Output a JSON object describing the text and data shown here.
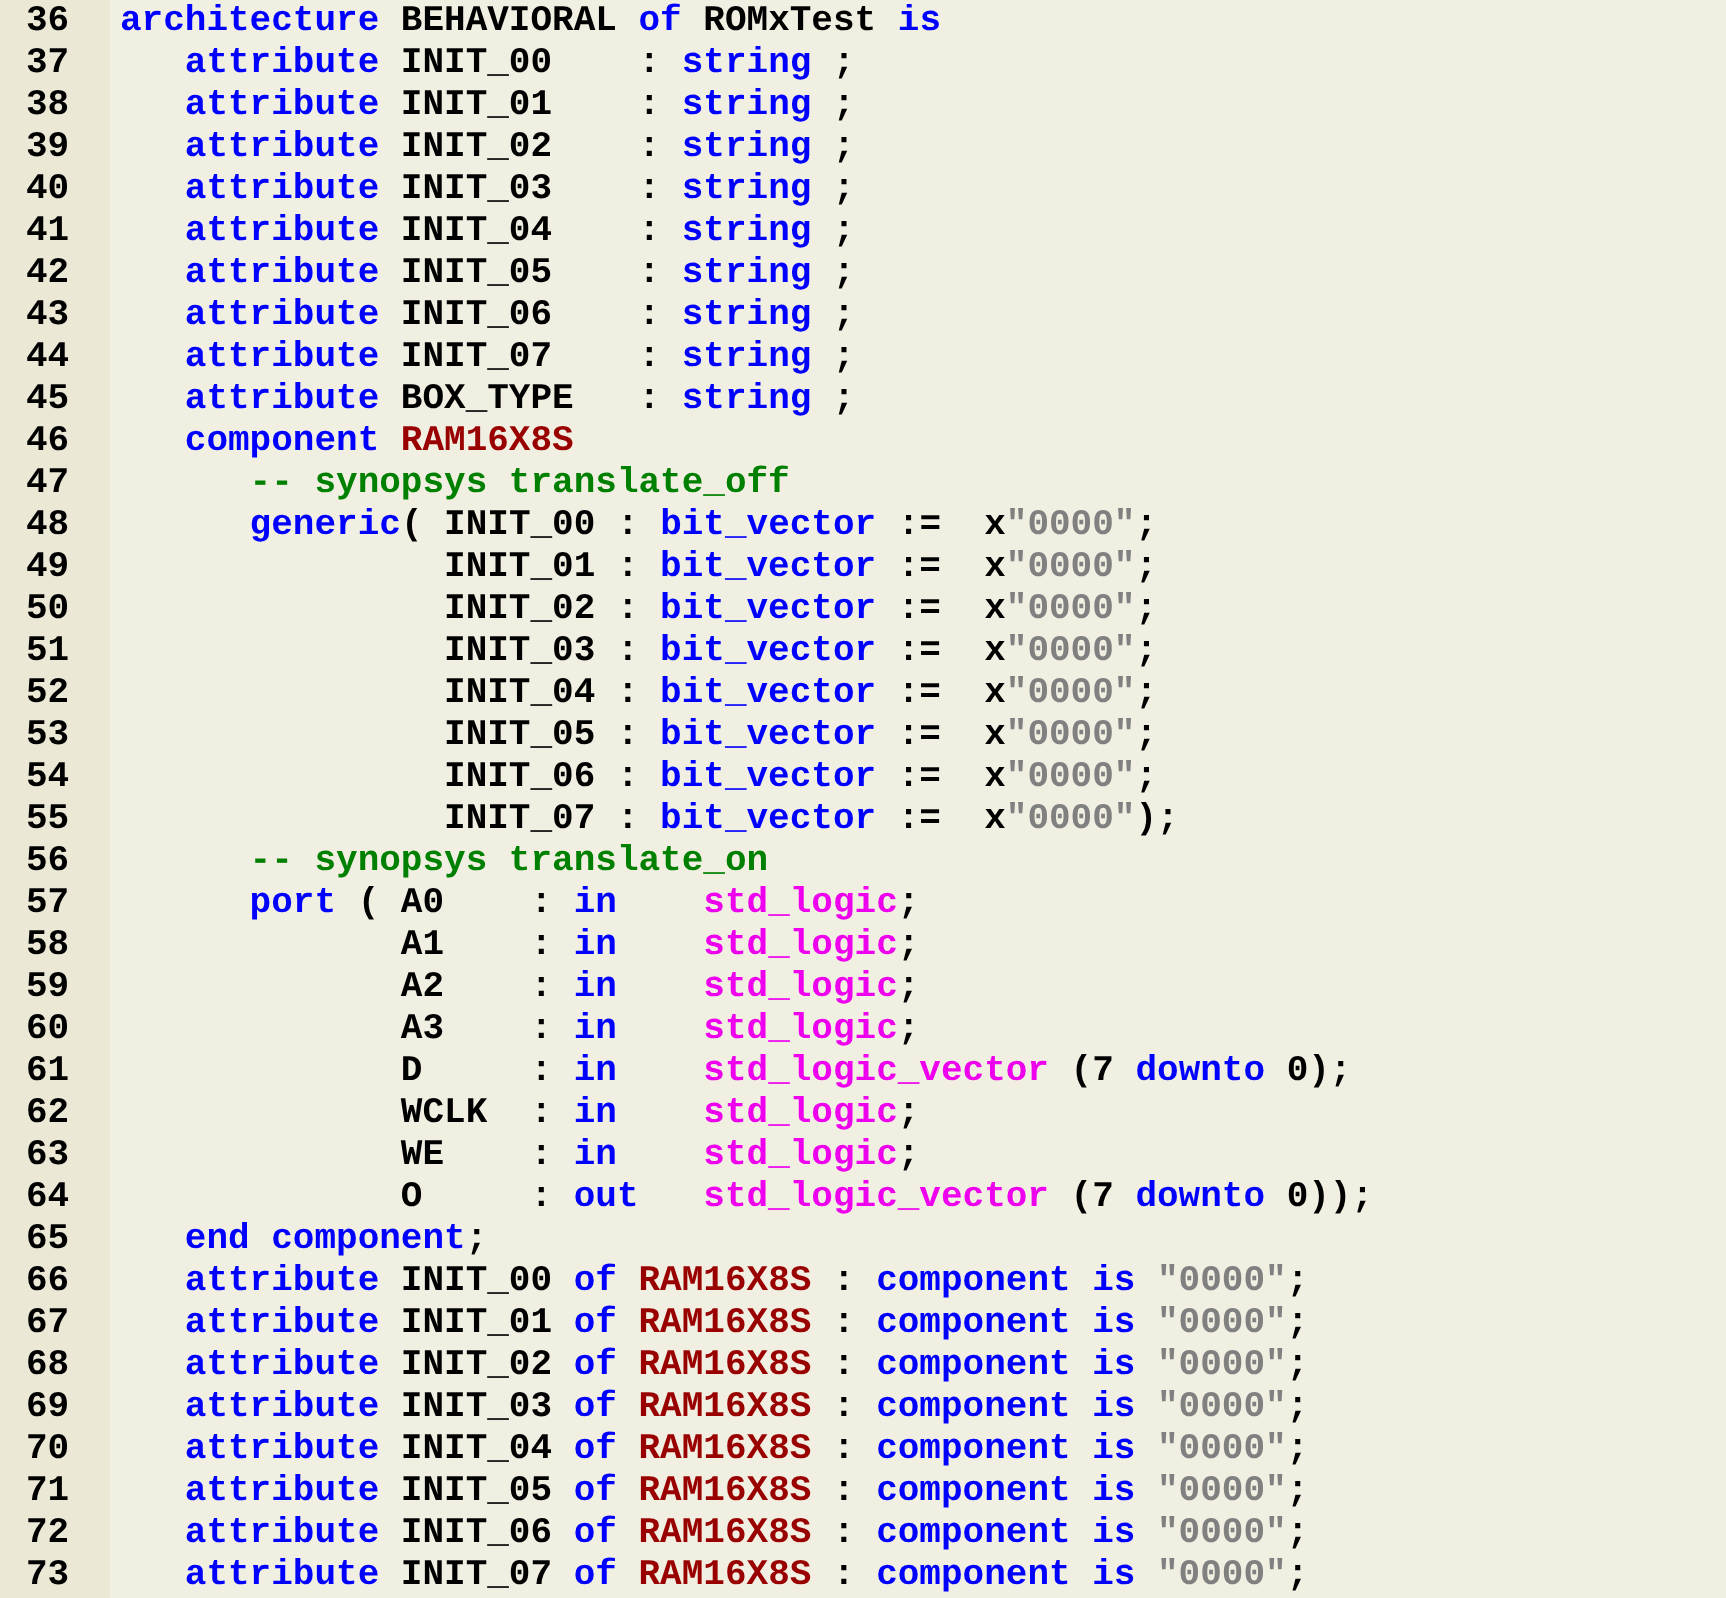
{
  "editor": {
    "lines": [
      {
        "number": "36",
        "tokens": [
          {
            "kind": "keyword",
            "text": "architecture"
          },
          {
            "kind": "plain",
            "text": " BEHAVIORAL "
          },
          {
            "kind": "keyword",
            "text": "of"
          },
          {
            "kind": "plain",
            "text": " ROMxTest "
          },
          {
            "kind": "keyword",
            "text": "is"
          }
        ]
      },
      {
        "number": "37",
        "tokens": [
          {
            "kind": "keyword",
            "text": "   attribute"
          },
          {
            "kind": "plain",
            "text": " INIT_00    : "
          },
          {
            "kind": "keyword",
            "text": "string"
          },
          {
            "kind": "plain",
            "text": " ;"
          }
        ]
      },
      {
        "number": "38",
        "tokens": [
          {
            "kind": "keyword",
            "text": "   attribute"
          },
          {
            "kind": "plain",
            "text": " INIT_01    : "
          },
          {
            "kind": "keyword",
            "text": "string"
          },
          {
            "kind": "plain",
            "text": " ;"
          }
        ]
      },
      {
        "number": "39",
        "tokens": [
          {
            "kind": "keyword",
            "text": "   attribute"
          },
          {
            "kind": "plain",
            "text": " INIT_02    : "
          },
          {
            "kind": "keyword",
            "text": "string"
          },
          {
            "kind": "plain",
            "text": " ;"
          }
        ]
      },
      {
        "number": "40",
        "tokens": [
          {
            "kind": "keyword",
            "text": "   attribute"
          },
          {
            "kind": "plain",
            "text": " INIT_03    : "
          },
          {
            "kind": "keyword",
            "text": "string"
          },
          {
            "kind": "plain",
            "text": " ;"
          }
        ]
      },
      {
        "number": "41",
        "tokens": [
          {
            "kind": "keyword",
            "text": "   attribute"
          },
          {
            "kind": "plain",
            "text": " INIT_04    : "
          },
          {
            "kind": "keyword",
            "text": "string"
          },
          {
            "kind": "plain",
            "text": " ;"
          }
        ]
      },
      {
        "number": "42",
        "tokens": [
          {
            "kind": "keyword",
            "text": "   attribute"
          },
          {
            "kind": "plain",
            "text": " INIT_05    : "
          },
          {
            "kind": "keyword",
            "text": "string"
          },
          {
            "kind": "plain",
            "text": " ;"
          }
        ]
      },
      {
        "number": "43",
        "tokens": [
          {
            "kind": "keyword",
            "text": "   attribute"
          },
          {
            "kind": "plain",
            "text": " INIT_06    : "
          },
          {
            "kind": "keyword",
            "text": "string"
          },
          {
            "kind": "plain",
            "text": " ;"
          }
        ]
      },
      {
        "number": "44",
        "tokens": [
          {
            "kind": "keyword",
            "text": "   attribute"
          },
          {
            "kind": "plain",
            "text": " INIT_07    : "
          },
          {
            "kind": "keyword",
            "text": "string"
          },
          {
            "kind": "plain",
            "text": " ;"
          }
        ]
      },
      {
        "number": "45",
        "tokens": [
          {
            "kind": "keyword",
            "text": "   attribute"
          },
          {
            "kind": "plain",
            "text": " BOX_TYPE   : "
          },
          {
            "kind": "keyword",
            "text": "string"
          },
          {
            "kind": "plain",
            "text": " ;"
          }
        ]
      },
      {
        "number": "46",
        "tokens": [
          {
            "kind": "keyword",
            "text": "   component"
          },
          {
            "kind": "name",
            "text": " RAM16X8S"
          }
        ]
      },
      {
        "number": "47",
        "tokens": [
          {
            "kind": "comment",
            "text": "      -- synopsys translate_off"
          }
        ]
      },
      {
        "number": "48",
        "tokens": [
          {
            "kind": "keyword",
            "text": "      generic"
          },
          {
            "kind": "plain",
            "text": "( INIT_00 : "
          },
          {
            "kind": "keyword",
            "text": "bit_vector"
          },
          {
            "kind": "plain",
            "text": " :=  x"
          },
          {
            "kind": "string",
            "text": "\"0000\""
          },
          {
            "kind": "plain",
            "text": ";"
          }
        ]
      },
      {
        "number": "49",
        "tokens": [
          {
            "kind": "plain",
            "text": "               INIT_01 : "
          },
          {
            "kind": "keyword",
            "text": "bit_vector"
          },
          {
            "kind": "plain",
            "text": " :=  x"
          },
          {
            "kind": "string",
            "text": "\"0000\""
          },
          {
            "kind": "plain",
            "text": ";"
          }
        ]
      },
      {
        "number": "50",
        "tokens": [
          {
            "kind": "plain",
            "text": "               INIT_02 : "
          },
          {
            "kind": "keyword",
            "text": "bit_vector"
          },
          {
            "kind": "plain",
            "text": " :=  x"
          },
          {
            "kind": "string",
            "text": "\"0000\""
          },
          {
            "kind": "plain",
            "text": ";"
          }
        ]
      },
      {
        "number": "51",
        "tokens": [
          {
            "kind": "plain",
            "text": "               INIT_03 : "
          },
          {
            "kind": "keyword",
            "text": "bit_vector"
          },
          {
            "kind": "plain",
            "text": " :=  x"
          },
          {
            "kind": "string",
            "text": "\"0000\""
          },
          {
            "kind": "plain",
            "text": ";"
          }
        ]
      },
      {
        "number": "52",
        "tokens": [
          {
            "kind": "plain",
            "text": "               INIT_04 : "
          },
          {
            "kind": "keyword",
            "text": "bit_vector"
          },
          {
            "kind": "plain",
            "text": " :=  x"
          },
          {
            "kind": "string",
            "text": "\"0000\""
          },
          {
            "kind": "plain",
            "text": ";"
          }
        ]
      },
      {
        "number": "53",
        "tokens": [
          {
            "kind": "plain",
            "text": "               INIT_05 : "
          },
          {
            "kind": "keyword",
            "text": "bit_vector"
          },
          {
            "kind": "plain",
            "text": " :=  x"
          },
          {
            "kind": "string",
            "text": "\"0000\""
          },
          {
            "kind": "plain",
            "text": ";"
          }
        ]
      },
      {
        "number": "54",
        "tokens": [
          {
            "kind": "plain",
            "text": "               INIT_06 : "
          },
          {
            "kind": "keyword",
            "text": "bit_vector"
          },
          {
            "kind": "plain",
            "text": " :=  x"
          },
          {
            "kind": "string",
            "text": "\"0000\""
          },
          {
            "kind": "plain",
            "text": ";"
          }
        ]
      },
      {
        "number": "55",
        "tokens": [
          {
            "kind": "plain",
            "text": "               INIT_07 : "
          },
          {
            "kind": "keyword",
            "text": "bit_vector"
          },
          {
            "kind": "plain",
            "text": " :=  x"
          },
          {
            "kind": "string",
            "text": "\"0000\""
          },
          {
            "kind": "plain",
            "text": ");"
          }
        ]
      },
      {
        "number": "56",
        "tokens": [
          {
            "kind": "comment",
            "text": "      -- synopsys translate_on"
          }
        ]
      },
      {
        "number": "57",
        "tokens": [
          {
            "kind": "keyword",
            "text": "      port"
          },
          {
            "kind": "plain",
            "text": " ( A0    : "
          },
          {
            "kind": "keyword",
            "text": "in"
          },
          {
            "kind": "type",
            "text": "    std_logic"
          },
          {
            "kind": "plain",
            "text": ";"
          }
        ]
      },
      {
        "number": "58",
        "tokens": [
          {
            "kind": "plain",
            "text": "             A1    : "
          },
          {
            "kind": "keyword",
            "text": "in"
          },
          {
            "kind": "type",
            "text": "    std_logic"
          },
          {
            "kind": "plain",
            "text": ";"
          }
        ]
      },
      {
        "number": "59",
        "tokens": [
          {
            "kind": "plain",
            "text": "             A2    : "
          },
          {
            "kind": "keyword",
            "text": "in"
          },
          {
            "kind": "type",
            "text": "    std_logic"
          },
          {
            "kind": "plain",
            "text": ";"
          }
        ]
      },
      {
        "number": "60",
        "tokens": [
          {
            "kind": "plain",
            "text": "             A3    : "
          },
          {
            "kind": "keyword",
            "text": "in"
          },
          {
            "kind": "type",
            "text": "    std_logic"
          },
          {
            "kind": "plain",
            "text": ";"
          }
        ]
      },
      {
        "number": "61",
        "tokens": [
          {
            "kind": "plain",
            "text": "             D     : "
          },
          {
            "kind": "keyword",
            "text": "in"
          },
          {
            "kind": "type",
            "text": "    std_logic_vector"
          },
          {
            "kind": "plain",
            "text": " (7 "
          },
          {
            "kind": "keyword",
            "text": "downto"
          },
          {
            "kind": "plain",
            "text": " 0);"
          }
        ]
      },
      {
        "number": "62",
        "tokens": [
          {
            "kind": "plain",
            "text": "             WCLK  : "
          },
          {
            "kind": "keyword",
            "text": "in"
          },
          {
            "kind": "type",
            "text": "    std_logic"
          },
          {
            "kind": "plain",
            "text": ";"
          }
        ]
      },
      {
        "number": "63",
        "tokens": [
          {
            "kind": "plain",
            "text": "             WE    : "
          },
          {
            "kind": "keyword",
            "text": "in"
          },
          {
            "kind": "type",
            "text": "    std_logic"
          },
          {
            "kind": "plain",
            "text": ";"
          }
        ]
      },
      {
        "number": "64",
        "tokens": [
          {
            "kind": "plain",
            "text": "             O     : "
          },
          {
            "kind": "keyword",
            "text": "out"
          },
          {
            "kind": "type",
            "text": "   std_logic_vector"
          },
          {
            "kind": "plain",
            "text": " (7 "
          },
          {
            "kind": "keyword",
            "text": "downto"
          },
          {
            "kind": "plain",
            "text": " 0));"
          }
        ]
      },
      {
        "number": "65",
        "tokens": [
          {
            "kind": "keyword",
            "text": "   end component"
          },
          {
            "kind": "plain",
            "text": ";"
          }
        ]
      },
      {
        "number": "66",
        "tokens": [
          {
            "kind": "keyword",
            "text": "   attribute"
          },
          {
            "kind": "plain",
            "text": " INIT_00 "
          },
          {
            "kind": "keyword",
            "text": "of"
          },
          {
            "kind": "name",
            "text": " RAM16X8S"
          },
          {
            "kind": "plain",
            "text": " : "
          },
          {
            "kind": "keyword",
            "text": "component is"
          },
          {
            "kind": "string",
            "text": " \"0000\""
          },
          {
            "kind": "plain",
            "text": ";"
          }
        ]
      },
      {
        "number": "67",
        "tokens": [
          {
            "kind": "keyword",
            "text": "   attribute"
          },
          {
            "kind": "plain",
            "text": " INIT_01 "
          },
          {
            "kind": "keyword",
            "text": "of"
          },
          {
            "kind": "name",
            "text": " RAM16X8S"
          },
          {
            "kind": "plain",
            "text": " : "
          },
          {
            "kind": "keyword",
            "text": "component is"
          },
          {
            "kind": "string",
            "text": " \"0000\""
          },
          {
            "kind": "plain",
            "text": ";"
          }
        ]
      },
      {
        "number": "68",
        "tokens": [
          {
            "kind": "keyword",
            "text": "   attribute"
          },
          {
            "kind": "plain",
            "text": " INIT_02 "
          },
          {
            "kind": "keyword",
            "text": "of"
          },
          {
            "kind": "name",
            "text": " RAM16X8S"
          },
          {
            "kind": "plain",
            "text": " : "
          },
          {
            "kind": "keyword",
            "text": "component is"
          },
          {
            "kind": "string",
            "text": " \"0000\""
          },
          {
            "kind": "plain",
            "text": ";"
          }
        ]
      },
      {
        "number": "69",
        "tokens": [
          {
            "kind": "keyword",
            "text": "   attribute"
          },
          {
            "kind": "plain",
            "text": " INIT_03 "
          },
          {
            "kind": "keyword",
            "text": "of"
          },
          {
            "kind": "name",
            "text": " RAM16X8S"
          },
          {
            "kind": "plain",
            "text": " : "
          },
          {
            "kind": "keyword",
            "text": "component is"
          },
          {
            "kind": "string",
            "text": " \"0000\""
          },
          {
            "kind": "plain",
            "text": ";"
          }
        ]
      },
      {
        "number": "70",
        "tokens": [
          {
            "kind": "keyword",
            "text": "   attribute"
          },
          {
            "kind": "plain",
            "text": " INIT_04 "
          },
          {
            "kind": "keyword",
            "text": "of"
          },
          {
            "kind": "name",
            "text": " RAM16X8S"
          },
          {
            "kind": "plain",
            "text": " : "
          },
          {
            "kind": "keyword",
            "text": "component is"
          },
          {
            "kind": "string",
            "text": " \"0000\""
          },
          {
            "kind": "plain",
            "text": ";"
          }
        ]
      },
      {
        "number": "71",
        "tokens": [
          {
            "kind": "keyword",
            "text": "   attribute"
          },
          {
            "kind": "plain",
            "text": " INIT_05 "
          },
          {
            "kind": "keyword",
            "text": "of"
          },
          {
            "kind": "name",
            "text": " RAM16X8S"
          },
          {
            "kind": "plain",
            "text": " : "
          },
          {
            "kind": "keyword",
            "text": "component is"
          },
          {
            "kind": "string",
            "text": " \"0000\""
          },
          {
            "kind": "plain",
            "text": ";"
          }
        ]
      },
      {
        "number": "72",
        "tokens": [
          {
            "kind": "keyword",
            "text": "   attribute"
          },
          {
            "kind": "plain",
            "text": " INIT_06 "
          },
          {
            "kind": "keyword",
            "text": "of"
          },
          {
            "kind": "name",
            "text": " RAM16X8S"
          },
          {
            "kind": "plain",
            "text": " : "
          },
          {
            "kind": "keyword",
            "text": "component is"
          },
          {
            "kind": "string",
            "text": " \"0000\""
          },
          {
            "kind": "plain",
            "text": ";"
          }
        ]
      },
      {
        "number": "73",
        "tokens": [
          {
            "kind": "keyword",
            "text": "   attribute"
          },
          {
            "kind": "plain",
            "text": " INIT_07 "
          },
          {
            "kind": "keyword",
            "text": "of"
          },
          {
            "kind": "name",
            "text": " RAM16X8S"
          },
          {
            "kind": "plain",
            "text": " : "
          },
          {
            "kind": "keyword",
            "text": "component is"
          },
          {
            "kind": "string",
            "text": " \"0000\""
          },
          {
            "kind": "plain",
            "text": ";"
          }
        ]
      }
    ]
  }
}
